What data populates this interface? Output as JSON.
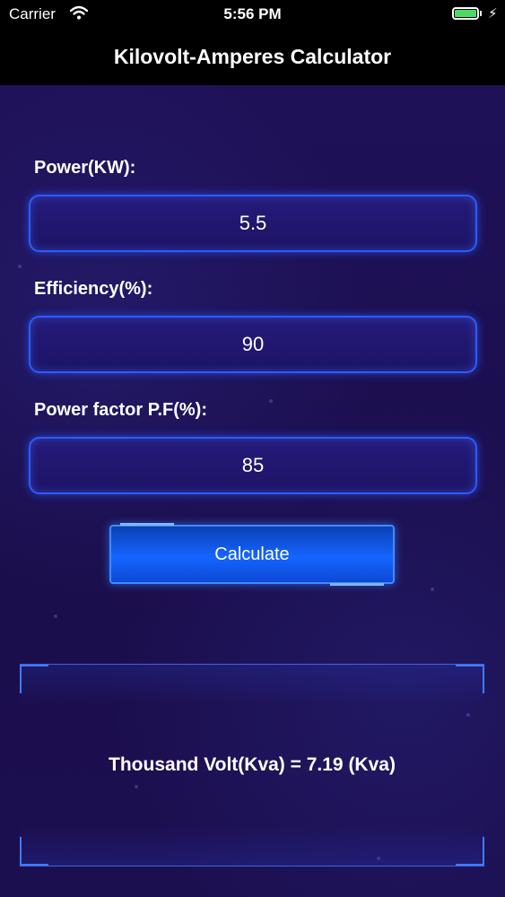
{
  "status_bar": {
    "carrier": "Carrier",
    "time": "5:56 PM",
    "wifi_icon": "wifi-icon",
    "battery_icon": "battery-icon",
    "charge_icon": "charging-bolt-icon",
    "battery_level": 1.0,
    "battery_color": "#4cd964"
  },
  "nav": {
    "title": "Kilovolt-Amperes Calculator"
  },
  "form": {
    "power_label": "Power(KW):",
    "power_value": "5.5",
    "efficiency_label": "Efficiency(%):",
    "efficiency_value": "90",
    "pf_label": "Power factor P.F(%):",
    "pf_value": "85"
  },
  "actions": {
    "calculate_label": "Calculate"
  },
  "result": {
    "text": "Thousand Volt(Kva) = 7.19 (Kva)"
  },
  "colors": {
    "background": "#1d0f52",
    "field_border": "#2e5bff",
    "button": "#1565ff",
    "bar": "#000000"
  }
}
